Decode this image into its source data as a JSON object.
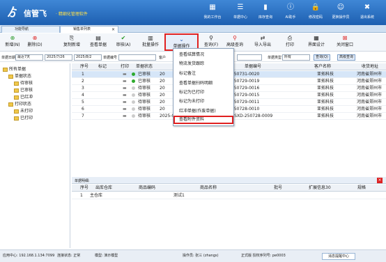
{
  "header": {
    "logo": "ゟ",
    "title": "信管飞",
    "subtitle": "· 精细化管理软件",
    "buttons": [
      {
        "label": "我的工作台",
        "icon": "desk-icon",
        "glyph": "▦"
      },
      {
        "label": "单据中心",
        "icon": "doc-icon",
        "glyph": "☰"
      },
      {
        "label": "库存查询",
        "icon": "stock-icon",
        "glyph": "▮"
      },
      {
        "label": "AI助手",
        "icon": "info-icon",
        "glyph": "ⓘ"
      },
      {
        "label": "修改密码",
        "icon": "lock-icon",
        "glyph": "🔒"
      },
      {
        "label": "更换操作员",
        "icon": "user-icon",
        "glyph": "☺"
      },
      {
        "label": "退出系统",
        "icon": "exit-icon",
        "glyph": "✖"
      }
    ]
  },
  "tabs": [
    {
      "label": "功能导航"
    },
    {
      "label": "销售单列表"
    }
  ],
  "toolbar": [
    {
      "label": "新增(N)",
      "glyph": "⊕"
    },
    {
      "label": "删除(D)",
      "glyph": "⊗"
    },
    {
      "label": "复制新增",
      "glyph": "⎘"
    },
    {
      "label": "查看单据",
      "glyph": "▤"
    },
    {
      "label": "审核(A)",
      "glyph": "✔"
    },
    {
      "label": "批量操作",
      "glyph": "▥"
    },
    {
      "label": "单据操作",
      "glyph": "⌄"
    },
    {
      "label": "查询(F)",
      "glyph": "⚲"
    },
    {
      "label": "高级查询",
      "glyph": "⚲"
    },
    {
      "label": "导入导出",
      "glyph": "⇄"
    },
    {
      "label": "打印",
      "glyph": "⎙"
    },
    {
      "label": "界面设计",
      "glyph": "▦"
    },
    {
      "label": "关闭窗口",
      "glyph": "⊠"
    }
  ],
  "filter": {
    "date_label": "单据日期",
    "date_range": "最近7天",
    "date_from": "2025/7/26",
    "date_to": "2025/8/2",
    "no_label": "单据编号",
    "cust_label": "客户",
    "type_label": "单据类型",
    "type_value": "所有",
    "query_btn": "查询(Q)",
    "adv_btn": "高级查询"
  },
  "tree": {
    "root": "所有单据",
    "status": "单据状态",
    "pending": "待审核",
    "approved": "已审核",
    "red": "已红冲",
    "print": "打印状态",
    "unprinted": "未打印",
    "printed": "已打印"
  },
  "grid": {
    "headers": [
      "序号",
      "标记",
      "打印",
      "单据状态",
      "",
      "单据编号",
      "客户名称",
      "收货地址"
    ],
    "rows": [
      {
        "n": "1",
        "status": "已审核",
        "color": "#2eaa2e",
        "date": "20",
        "no": "250731-0020",
        "cust": "亚拓科技",
        "addr": "河南省郑州市"
      },
      {
        "n": "2",
        "status": "已审核",
        "color": "#2eaa2e",
        "date": "20",
        "no": "250729-0019",
        "cust": "亚拓科技",
        "addr": "河南省郑州市"
      },
      {
        "n": "3",
        "status": "待审核",
        "color": "#cccccc",
        "date": "20",
        "no": "250729-0016",
        "cust": "亚拓科技",
        "addr": "河南省郑州市"
      },
      {
        "n": "4",
        "status": "待审核",
        "color": "#cccccc",
        "date": "20",
        "no": "250729-0015",
        "cust": "亚拓科技",
        "addr": "河南省郑州市"
      },
      {
        "n": "5",
        "status": "待审核",
        "color": "#cccccc",
        "date": "20",
        "no": "250729-0011",
        "cust": "亚拓科技",
        "addr": "河南省郑州市"
      },
      {
        "n": "6",
        "status": "待审核",
        "color": "#cccccc",
        "date": "20",
        "no": "250728-0010",
        "cust": "亚拓科技",
        "addr": "河南省郑州市"
      },
      {
        "n": "7",
        "status": "待审核",
        "color": "#cccccc",
        "date": "2025-07-28 14:22",
        "no": "XSXD-250728-0009",
        "cust": "亚拓科技",
        "addr": "河南省郑州市"
      }
    ]
  },
  "menu": [
    "查看结算情况",
    "物流发货跟踪",
    "标记备注",
    "查看单据扫码明细",
    "标记为已打印",
    "标记为未打印",
    "红冲单据(作废单据)",
    "查看附件资料"
  ],
  "detail": {
    "title": "单据明细:",
    "headers": [
      "序号",
      "出库仓库",
      "商品编码",
      "商品名称",
      "批号",
      "扩展信息30",
      "规格"
    ],
    "row": {
      "n": "1",
      "wh": "主仓库",
      "code": "",
      "name": "测试1",
      "batch": "",
      "ext": "",
      "spec": ""
    }
  },
  "status": {
    "server": "应用中心: 192.168.1.134:7099",
    "conn": "连接状态: 正常",
    "mode": "模型: 演示模型",
    "op": "操作员: 张三 (zhangs)",
    "ver": "正式版 授权序列号: pe0003",
    "help": "消息提醒中心"
  }
}
